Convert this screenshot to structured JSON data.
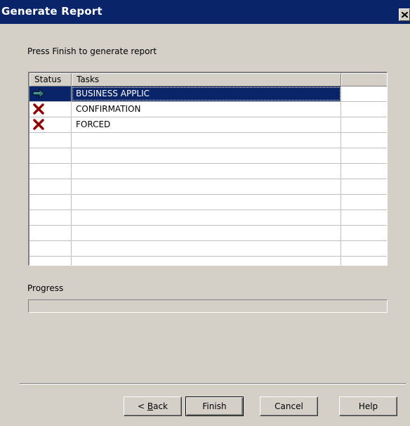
{
  "window": {
    "title": "Generate Report",
    "close_icon": "close-icon"
  },
  "instruction": "Press Finish to generate report",
  "list": {
    "columns": [
      "Status",
      "Tasks",
      ""
    ],
    "rows": [
      {
        "status": "arrow-right-icon",
        "task": "BUSINESS APPLIC",
        "selected": true
      },
      {
        "status": "red-x-icon",
        "task": "CONFIRMATION",
        "selected": false
      },
      {
        "status": "red-x-icon",
        "task": "FORCED",
        "selected": false
      },
      {
        "status": "",
        "task": "",
        "selected": false
      },
      {
        "status": "",
        "task": "",
        "selected": false
      },
      {
        "status": "",
        "task": "",
        "selected": false
      },
      {
        "status": "",
        "task": "",
        "selected": false
      },
      {
        "status": "",
        "task": "",
        "selected": false
      },
      {
        "status": "",
        "task": "",
        "selected": false
      },
      {
        "status": "",
        "task": "",
        "selected": false
      },
      {
        "status": "",
        "task": "",
        "selected": false
      },
      {
        "status": "",
        "task": "",
        "selected": false
      }
    ]
  },
  "progress": {
    "label": "Progress",
    "fraction": 0
  },
  "buttons": {
    "back": {
      "prefix": "< ",
      "accel": "B",
      "rest": "ack"
    },
    "finish": "Finish",
    "cancel": "Cancel",
    "help": "Help"
  },
  "colors": {
    "selection": "#0a246a",
    "dialog_bg": "#d4d0c8",
    "error": "#b00000",
    "arrow": "#2a7a7a"
  }
}
